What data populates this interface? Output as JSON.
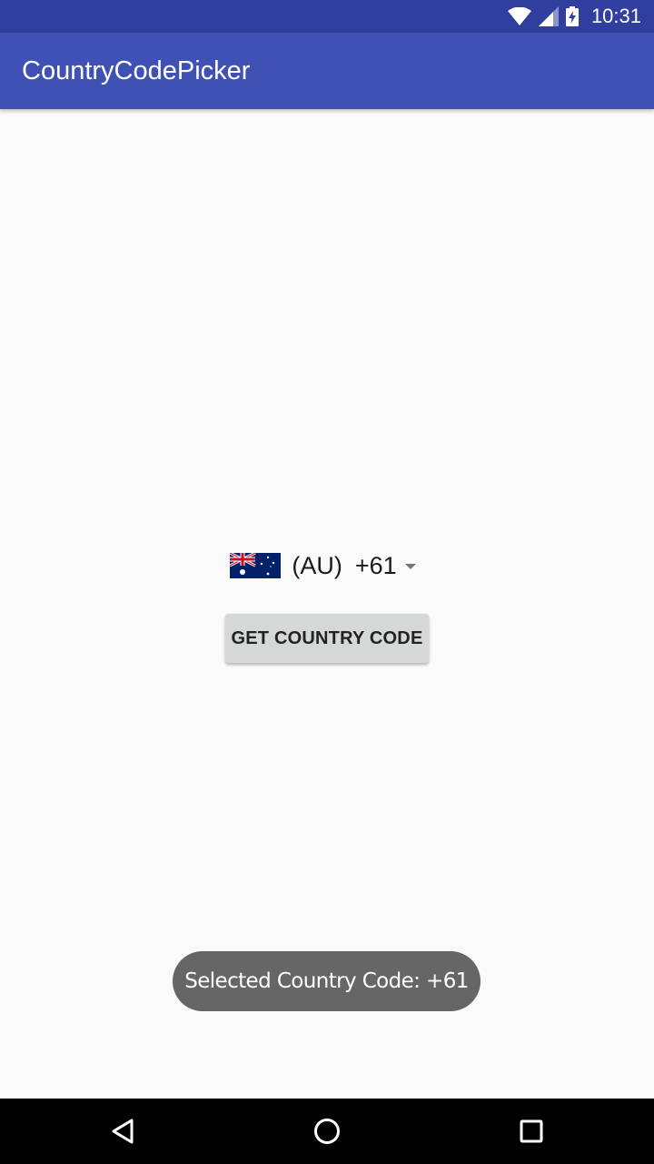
{
  "status_bar": {
    "time": "10:31",
    "icons": [
      "wifi-icon",
      "cell-signal-icon",
      "battery-charging-icon"
    ]
  },
  "app_bar": {
    "title": "CountryCodePicker"
  },
  "picker": {
    "flag": "australia-flag-icon",
    "country_abbr": "(AU)",
    "country_code": "+61",
    "dropdown": "dropdown-arrow-icon"
  },
  "button": {
    "label": "GET COUNTRY CODE"
  },
  "toast": {
    "message": "Selected Country Code: +61"
  },
  "nav_bar": {
    "items": [
      "back-icon",
      "home-icon",
      "recents-icon"
    ]
  },
  "colors": {
    "status_bar": "#303f9f",
    "app_bar": "#3f51b5",
    "background": "#fafafa",
    "button": "#d6d7d7",
    "toast": "#666666",
    "nav_bar": "#000000"
  }
}
